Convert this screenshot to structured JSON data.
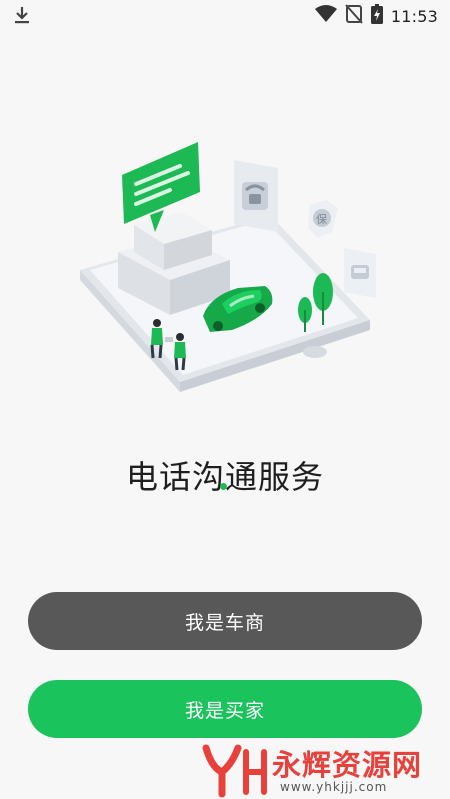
{
  "status_bar": {
    "time": "11:53",
    "icons": [
      "download-icon",
      "wifi-icon",
      "no-signal-icon",
      "battery-icon"
    ]
  },
  "illustration": {
    "icons": [
      "chat-bubble-icon",
      "telephone-icon",
      "shield-icon",
      "car-badge-icon",
      "car-icon",
      "tree-icon",
      "people-icon"
    ]
  },
  "main": {
    "headline": "电话沟通服务"
  },
  "buttons": {
    "dealer_label": "我是车商",
    "buyer_label": "我是买家"
  },
  "watermark": {
    "text": "永辉资源网",
    "url": "www.yhkjjj.com"
  },
  "colors": {
    "accent_green": "#1bc35c",
    "dark_button": "#585858",
    "watermark_red": "#e8403a"
  }
}
